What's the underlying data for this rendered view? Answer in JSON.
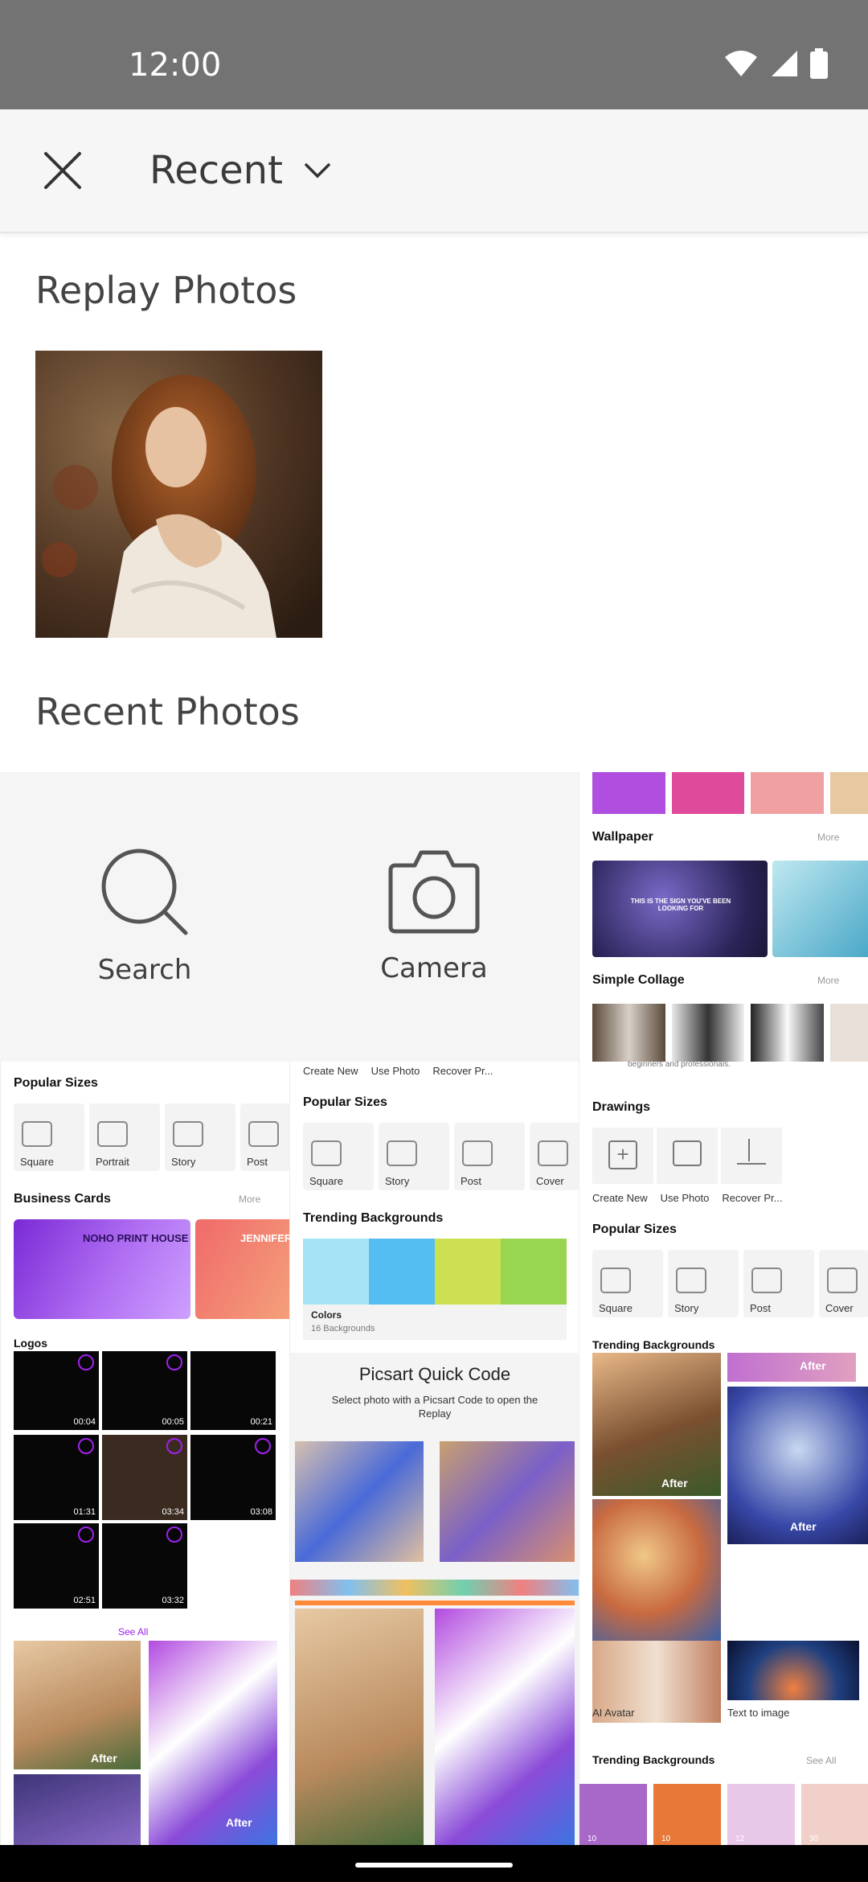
{
  "status_bar": {
    "time": "12:00"
  },
  "app_bar": {
    "album_label": "Recent"
  },
  "sections": {
    "replay_title": "Replay Photos",
    "recent_title": "Recent Photos"
  },
  "tiles": {
    "search_label": "Search",
    "camera_label": "Camera"
  },
  "shot1": {
    "popular_sizes": "Popular Sizes",
    "sizes": [
      "Square",
      "Portrait",
      "Story",
      "Post"
    ],
    "business_cards": "Business Cards",
    "more": "More",
    "card1_name": "NOHO PRINT HOUSE",
    "card2_name": "JENNIFER",
    "logos": "Logos",
    "durations": [
      "00:04",
      "00:05",
      "00:21",
      "01:31",
      "03:34",
      "03:08",
      "02:51",
      "03:32"
    ],
    "see_all": "See All",
    "after": "After"
  },
  "shot2": {
    "tools": [
      "Create New",
      "Use Photo",
      "Recover Pr..."
    ],
    "popular_sizes": "Popular Sizes",
    "sizes": [
      "Square",
      "Story",
      "Post",
      "Cover"
    ],
    "trending": "Trending Backgrounds",
    "colors": "Colors",
    "colors_count": "16 Backgrounds",
    "quick_code_title": "Picsart Quick Code",
    "quick_code_desc": "Select photo with a Picsart Code to open the Replay"
  },
  "shot3": {
    "wallpaper": "Wallpaper",
    "more": "More",
    "wallpaper_quote": "THIS IS THE SIGN YOU'VE BEEN LOOKING FOR",
    "simple_collage": "Simple Collage",
    "beginners": "beginners and professionals.",
    "drawings": "Drawings",
    "tools": [
      "Create New",
      "Use Photo",
      "Recover Pr..."
    ],
    "popular_sizes": "Popular Sizes",
    "sizes": [
      "Square",
      "Story",
      "Post",
      "Cover"
    ],
    "trending": "Trending Backgrounds",
    "after": "After",
    "ai_avatar": "AI Avatar",
    "text_to_image": "Text to image",
    "trending_bottom": "Trending Backgrounds",
    "see_all": "See All",
    "counts": [
      "10",
      "10",
      "12",
      "30"
    ]
  },
  "colors": {
    "status_bar": "#737373",
    "app_bar": "#f6f6f6",
    "tile_bg": "#f5f5f6",
    "accent_purple": "#a020f0",
    "swatches": [
      "#a7e3f7",
      "#54bdf2",
      "#cde052",
      "#98d651"
    ]
  }
}
